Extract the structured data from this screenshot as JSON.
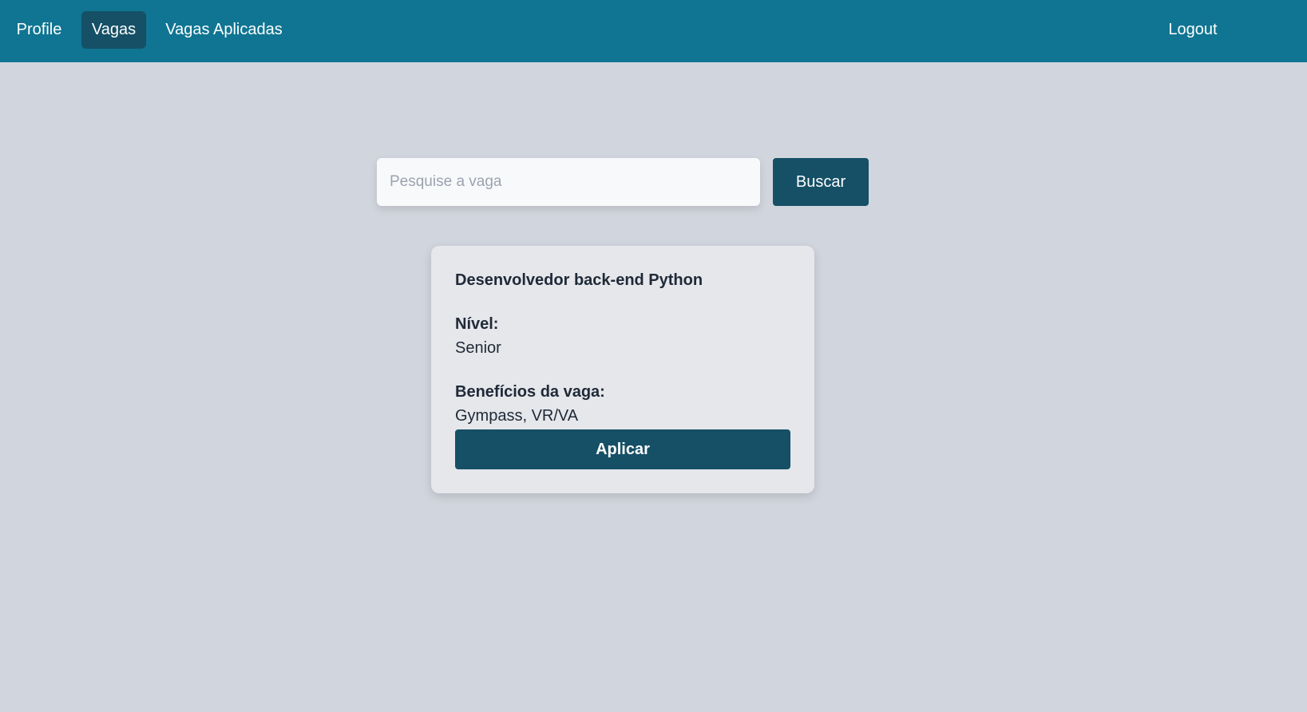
{
  "nav": {
    "items": [
      {
        "label": "Profile",
        "active": false
      },
      {
        "label": "Vagas",
        "active": true
      },
      {
        "label": "Vagas Aplicadas",
        "active": false
      }
    ],
    "logout_label": "Logout"
  },
  "search": {
    "placeholder": "Pesquise a vaga",
    "value": "",
    "button_label": "Buscar"
  },
  "job": {
    "title": "Desenvolvedor back-end Python",
    "level_label": "Nível:",
    "level_value": "Senior",
    "benefits_label": "Benefícios da vaga:",
    "benefits_value": "Gympass, VR/VA",
    "apply_label": "Aplicar"
  },
  "colors": {
    "navbar": "#0f7592",
    "active_nav": "#155066",
    "primary_button": "#155066",
    "background": "#d1d5dd",
    "card": "#e5e7eb"
  }
}
